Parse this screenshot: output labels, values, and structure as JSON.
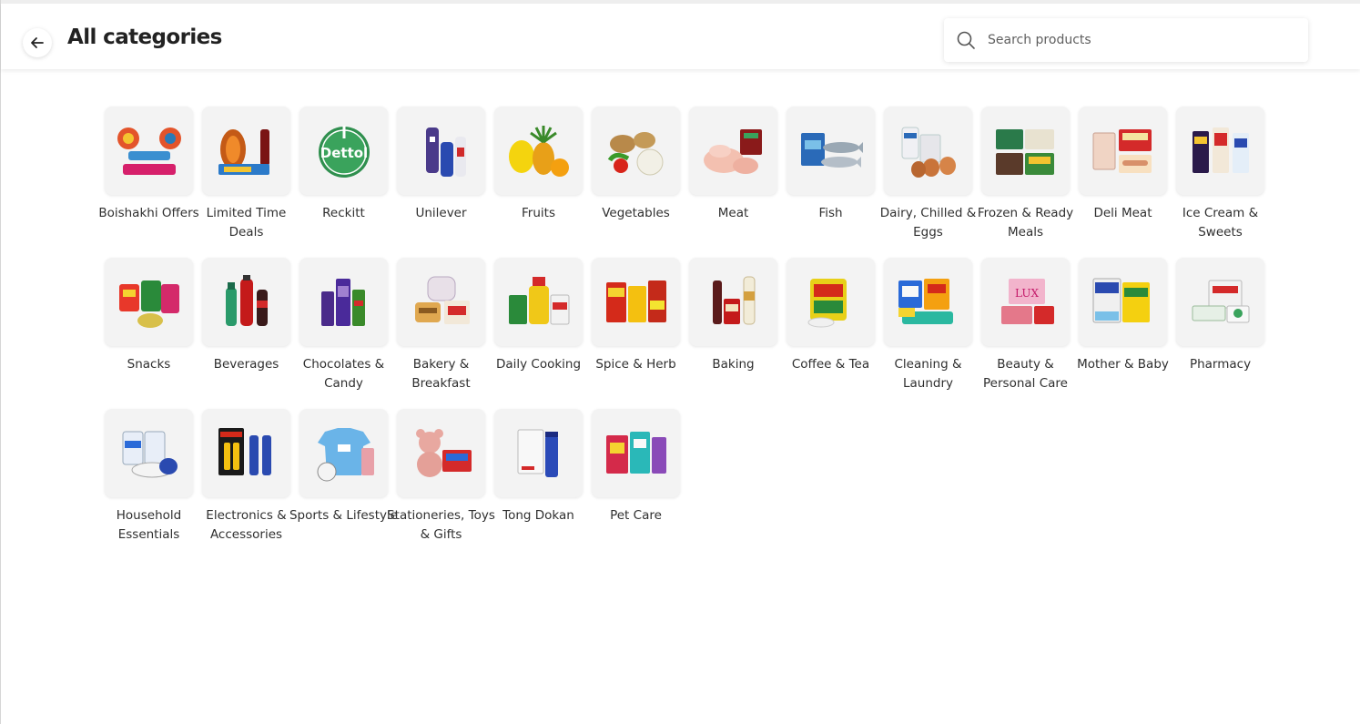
{
  "header": {
    "title": "All categories",
    "back_icon": "arrow-left-icon",
    "search": {
      "placeholder": "Search products",
      "value": "",
      "icon": "search-icon"
    }
  },
  "categories": [
    {
      "label": "Boishakhi Offers",
      "icon": "boishakhi-festival-icon"
    },
    {
      "label": "Limited Time Deals",
      "icon": "limited-deals-icon"
    },
    {
      "label": "Reckitt",
      "icon": "dettol-logo-icon"
    },
    {
      "label": "Unilever",
      "icon": "unilever-products-icon"
    },
    {
      "label": "Fruits",
      "icon": "fruits-icon"
    },
    {
      "label": "Vegetables",
      "icon": "vegetables-icon"
    },
    {
      "label": "Meat",
      "icon": "meat-icon"
    },
    {
      "label": "Fish",
      "icon": "fish-icon"
    },
    {
      "label": "Dairy, Chilled & Eggs",
      "icon": "dairy-eggs-icon"
    },
    {
      "label": "Frozen & Ready Meals",
      "icon": "frozen-meals-icon"
    },
    {
      "label": "Deli Meat",
      "icon": "deli-meat-icon"
    },
    {
      "label": "Ice Cream & Sweets",
      "icon": "ice-cream-icon"
    },
    {
      "label": "Snacks",
      "icon": "snacks-icon"
    },
    {
      "label": "Beverages",
      "icon": "beverages-icon"
    },
    {
      "label": "Chocolates & Candy",
      "icon": "chocolates-icon"
    },
    {
      "label": "Bakery & Breakfast",
      "icon": "bakery-icon"
    },
    {
      "label": "Daily Cooking",
      "icon": "cooking-oil-icon"
    },
    {
      "label": "Spice & Herb",
      "icon": "spice-icon"
    },
    {
      "label": "Baking",
      "icon": "baking-icon"
    },
    {
      "label": "Coffee & Tea",
      "icon": "coffee-tea-icon"
    },
    {
      "label": "Cleaning & Laundry",
      "icon": "cleaning-icon"
    },
    {
      "label": "Beauty & Personal Care",
      "icon": "beauty-icon"
    },
    {
      "label": "Mother & Baby",
      "icon": "baby-formula-icon"
    },
    {
      "label": "Pharmacy",
      "icon": "pharmacy-icon"
    },
    {
      "label": "Household Essentials",
      "icon": "tissue-icon"
    },
    {
      "label": "Electronics & Accessories",
      "icon": "battery-icon"
    },
    {
      "label": "Sports & Lifestyle",
      "icon": "jersey-ball-icon"
    },
    {
      "label": "Stationeries, Toys & Gifts",
      "icon": "teddy-bear-icon"
    },
    {
      "label": "Tong Dokan",
      "icon": "tong-dokan-icon"
    },
    {
      "label": "Pet Care",
      "icon": "pet-food-icon"
    }
  ],
  "colors": {
    "title": "#222222",
    "tile_background": "#f3f3f3",
    "label": "#2f2f2f"
  }
}
